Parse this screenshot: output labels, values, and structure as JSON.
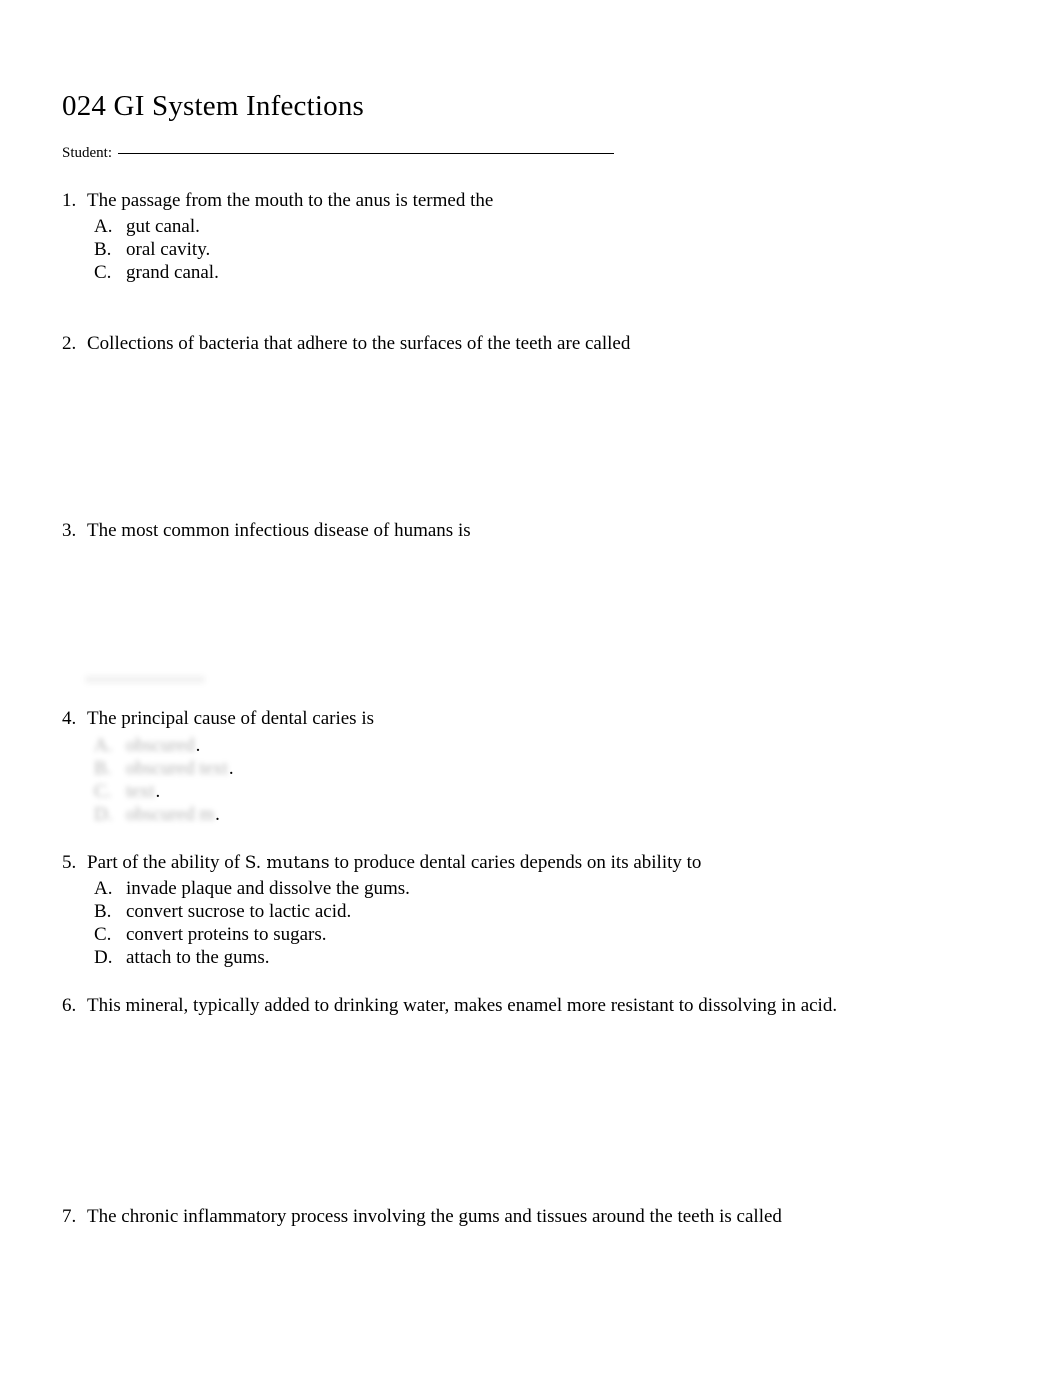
{
  "document": {
    "title": "024 GI System Infections",
    "student_label": "Student:",
    "student_value": ""
  },
  "questions": [
    {
      "number": "1.",
      "text": "The passage from the mouth to the anus is termed the",
      "options": [
        {
          "letter": "A.",
          "text": "gut canal."
        },
        {
          "letter": "B.",
          "text": "oral cavity."
        },
        {
          "letter": "C.",
          "text": "grand canal."
        }
      ]
    },
    {
      "number": "2.",
      "text": "Collections of bacteria that adhere to the surfaces of the teeth are called",
      "options": []
    },
    {
      "number": "3.",
      "text": "The most common infectious disease of humans is",
      "options": []
    },
    {
      "number": "4.",
      "text": "The principal cause of dental caries is",
      "options_obscured": [
        {
          "letter": "A.",
          "text": "obscured",
          "dot": "."
        },
        {
          "letter": "B.",
          "text": "obscured text",
          "dot": "."
        },
        {
          "letter": "C.",
          "text": "text",
          "dot": "."
        },
        {
          "letter": "D.",
          "text": "obscured m",
          "dot": "."
        }
      ]
    },
    {
      "number": "5.",
      "text_before": "Part of the ability of ",
      "species": "S. mutans",
      "text_after": " to produce dental caries depends on its ability to",
      "options": [
        {
          "letter": "A.",
          "text": "invade plaque and dissolve the gums."
        },
        {
          "letter": "B.",
          "text": "convert sucrose to lactic acid."
        },
        {
          "letter": "C.",
          "text": "convert proteins to sugars."
        },
        {
          "letter": "D.",
          "text": "attach to the gums."
        }
      ]
    },
    {
      "number": "6.",
      "text": "This mineral, typically added to drinking water, makes enamel more resistant to dissolving in acid.",
      "options": []
    },
    {
      "number": "7.",
      "text": "The chronic inflammatory process involving the gums and tissues around the teeth is called",
      "options": []
    }
  ]
}
